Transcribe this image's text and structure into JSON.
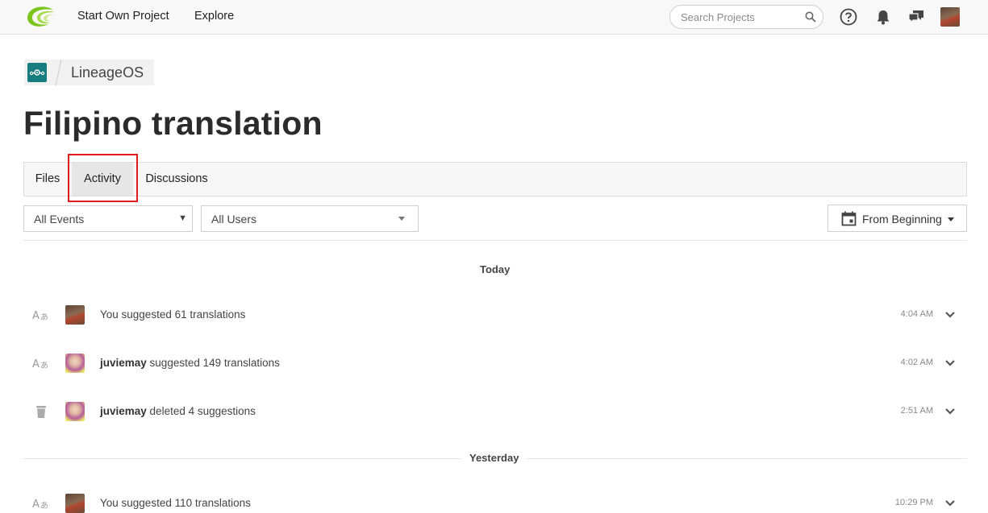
{
  "topbar": {
    "nav": [
      "Start Own Project",
      "Explore"
    ],
    "search_placeholder": "Search Projects"
  },
  "project": {
    "name": "LineageOS"
  },
  "page_title": "Filipino translation",
  "tabs": [
    {
      "label": "Files",
      "active": false
    },
    {
      "label": "Activity",
      "active": true
    },
    {
      "label": "Discussions",
      "active": false
    }
  ],
  "filters": {
    "events": "All Events",
    "users": "All Users",
    "date": "From Beginning"
  },
  "groups": [
    {
      "label": "Today",
      "items": [
        {
          "icon": "translate-icon",
          "user": "",
          "text": "You suggested 61 translations",
          "time": "4:04 AM"
        },
        {
          "icon": "translate-icon",
          "user": "juviemay",
          "text": " suggested 149 translations",
          "time": "4:02 AM"
        },
        {
          "icon": "trash-icon",
          "user": "juviemay",
          "text": " deleted 4 suggestions",
          "time": "2:51 AM"
        }
      ]
    },
    {
      "label": "Yesterday",
      "items": [
        {
          "icon": "translate-icon",
          "user": "",
          "text": "You suggested 110 translations",
          "time": "10:29 PM"
        }
      ]
    }
  ],
  "colors": {
    "highlight": "#e01b1b",
    "project_logo": "#167c80",
    "logo_green": "#7cc51e"
  }
}
